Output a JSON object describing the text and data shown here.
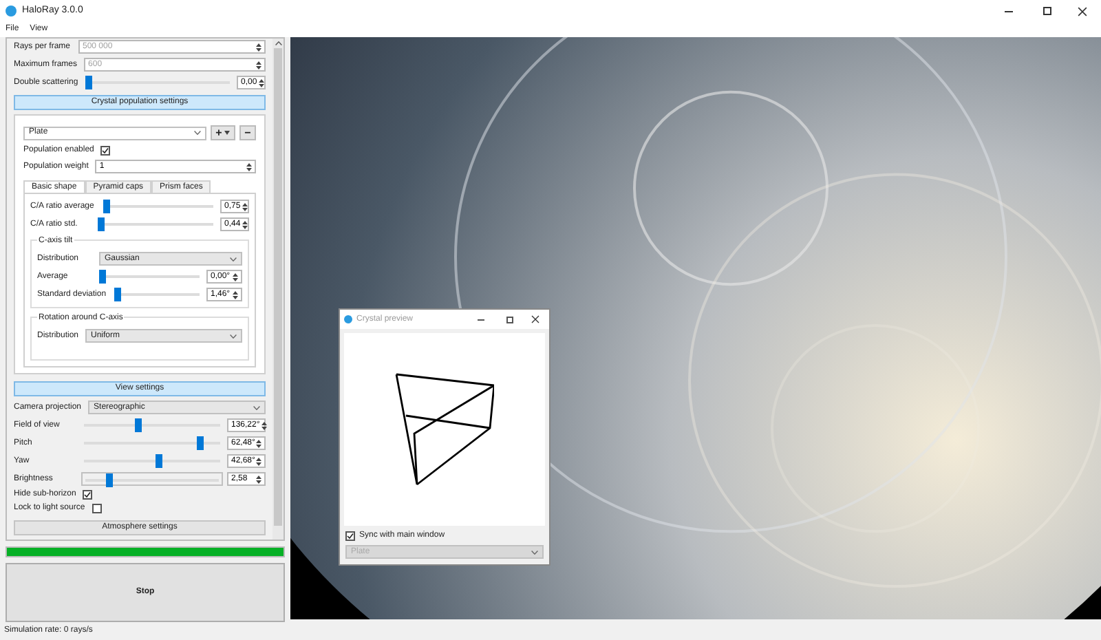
{
  "window": {
    "title": "HaloRay 3.0.0"
  },
  "menu": [
    "File",
    "View"
  ],
  "simulation_settings": [
    {
      "kind": "spin",
      "label": "Rays per frame",
      "value": "500 000",
      "disabled": true
    },
    {
      "kind": "spin",
      "label": "Maximum frames",
      "value": "600",
      "disabled": true
    },
    {
      "kind": "slider",
      "label": "Double scattering",
      "level": 0.0,
      "value": "0,00",
      "disabled": false
    }
  ],
  "crystal_section": {
    "title": "Crystal population settings",
    "population": "Plate",
    "add_button": "+",
    "remove_button": "−",
    "enabled_label": "Population enabled",
    "enabled": true,
    "weight_label": "Population weight",
    "weight": "1",
    "tabs": [
      {
        "label": "Basic shape",
        "selected": true
      },
      {
        "label": "Pyramid caps",
        "selected": false
      },
      {
        "label": "Prism faces",
        "selected": false
      }
    ],
    "sliders": [
      {
        "label": "C/A ratio average",
        "level": 0.02,
        "value": "0,75"
      },
      {
        "label": "C/A ratio std.",
        "level": 0.02,
        "value": "0,44"
      }
    ],
    "c_axis_tilt": {
      "title": "C-axis tilt",
      "distribution_label": "Distribution",
      "distribution": "Gaussian",
      "sliders": [
        {
          "label": "Average",
          "level": 0.0,
          "value": "0,00°"
        },
        {
          "label": "Standard deviation",
          "level": 0.02,
          "value": "1,46°"
        }
      ]
    },
    "rotation": {
      "title": "Rotation around C-axis",
      "distribution_label": "Distribution",
      "distribution": "Uniform"
    }
  },
  "view_section": {
    "title": "View settings",
    "projection_label": "Camera projection",
    "projection": "Stereographic",
    "sliders": [
      {
        "label": "Field of view",
        "level": 0.4,
        "value": "136,22°",
        "framed": false
      },
      {
        "label": "Pitch",
        "level": 0.86,
        "value": "62,48°",
        "framed": false
      },
      {
        "label": "Yaw",
        "level": 0.55,
        "value": "42,68°",
        "framed": false
      },
      {
        "label": "Brightness",
        "level": 0.18,
        "value": "2,58",
        "framed": true
      }
    ],
    "checks": [
      {
        "label": "Hide sub-horizon",
        "checked": true
      },
      {
        "label": "Lock to light source",
        "checked": false
      }
    ]
  },
  "atmosphere_button": "Atmosphere settings",
  "progress": {
    "level": 1.0
  },
  "stop_button": "Stop",
  "status_bar": "Simulation rate: 0 rays/s",
  "preview": {
    "title": "Crystal preview",
    "sync_label": "Sync with main window",
    "sync": true,
    "population": "Plate",
    "population_disabled": true
  }
}
